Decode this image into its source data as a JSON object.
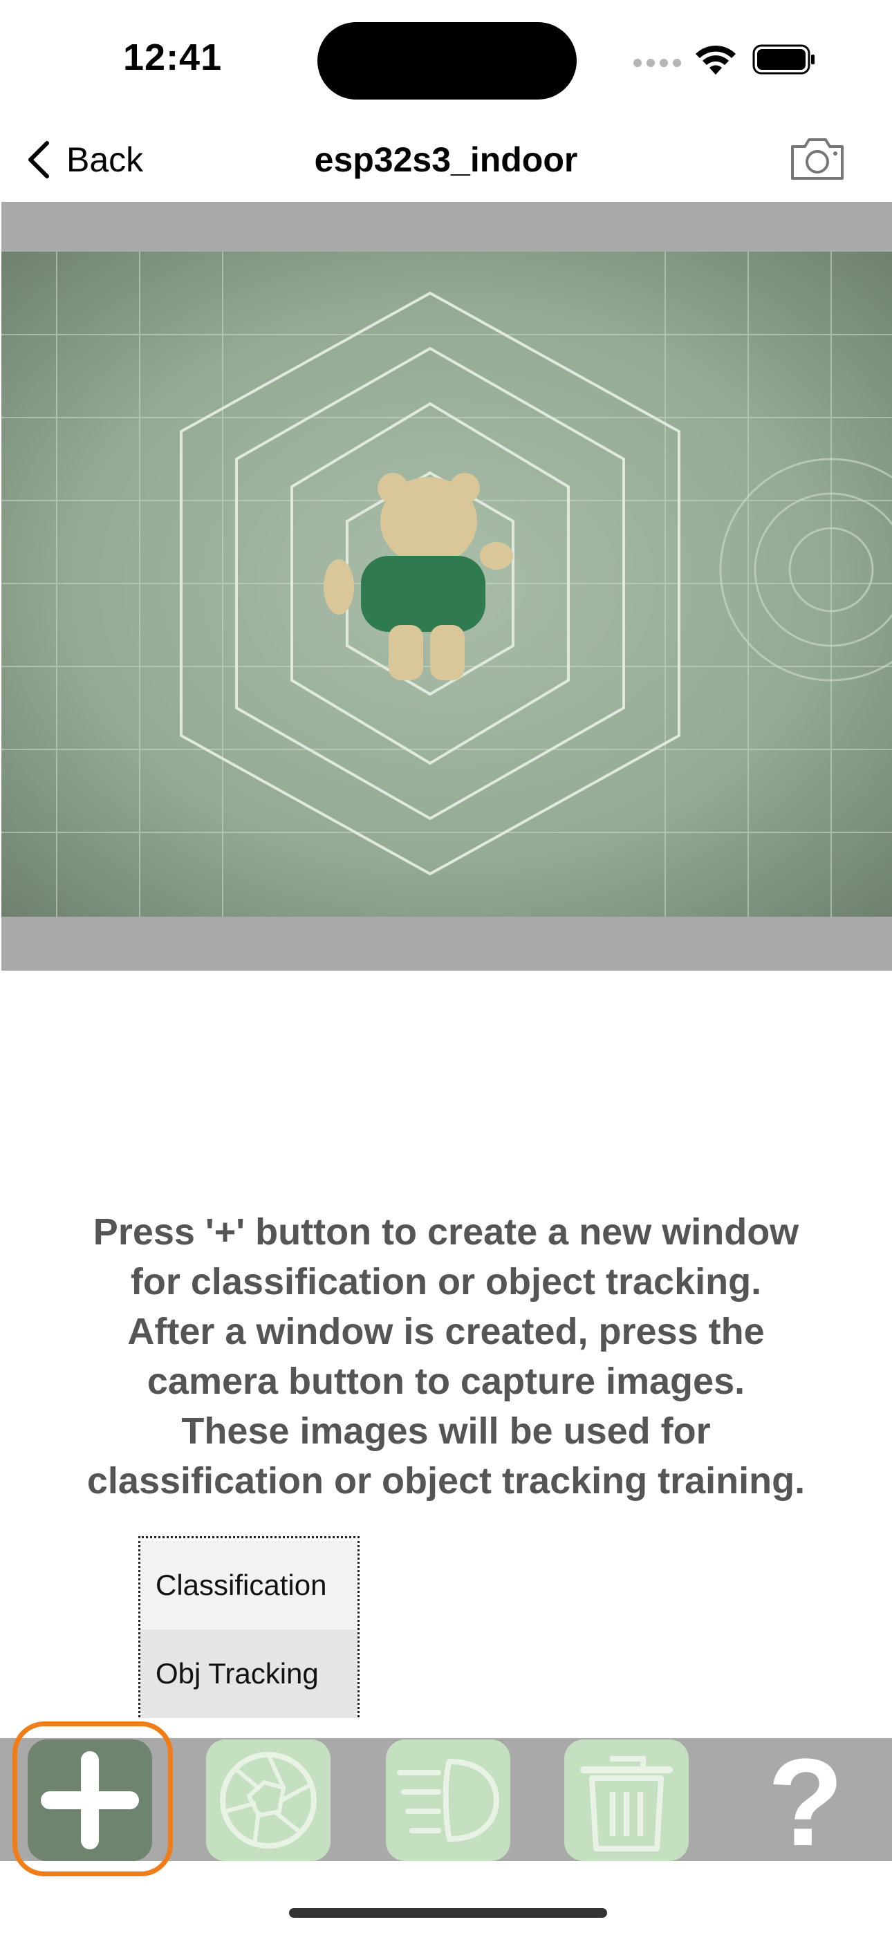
{
  "status_bar": {
    "time": "12:41",
    "icons": [
      "cellular-signal-icon",
      "wifi-icon",
      "battery-icon"
    ]
  },
  "nav": {
    "back_label": "Back",
    "title": "esp32s3_indoor",
    "right_icon": "camera-icon"
  },
  "preview": {
    "description_icon": "camera-preview-image"
  },
  "instruction": {
    "lines": [
      "Press '+' button to create a new window",
      "for classification or object tracking.",
      "After a window is created, press the",
      "camera button to capture images.",
      "These images will be used for",
      "classification or object tracking training."
    ]
  },
  "menu": {
    "items": [
      "Classification",
      "Obj Tracking"
    ]
  },
  "toolbar": {
    "buttons": [
      "add-icon",
      "shutter-icon",
      "headlight-icon",
      "trash-icon",
      "help-icon"
    ],
    "help_label": "?",
    "active_color": "#f07d18"
  },
  "colors": {
    "accent": "#f07d18",
    "toolbar_bg": "#a9a9a9",
    "disabled_button": "#c4e0c0",
    "add_button": "#6f846f"
  }
}
